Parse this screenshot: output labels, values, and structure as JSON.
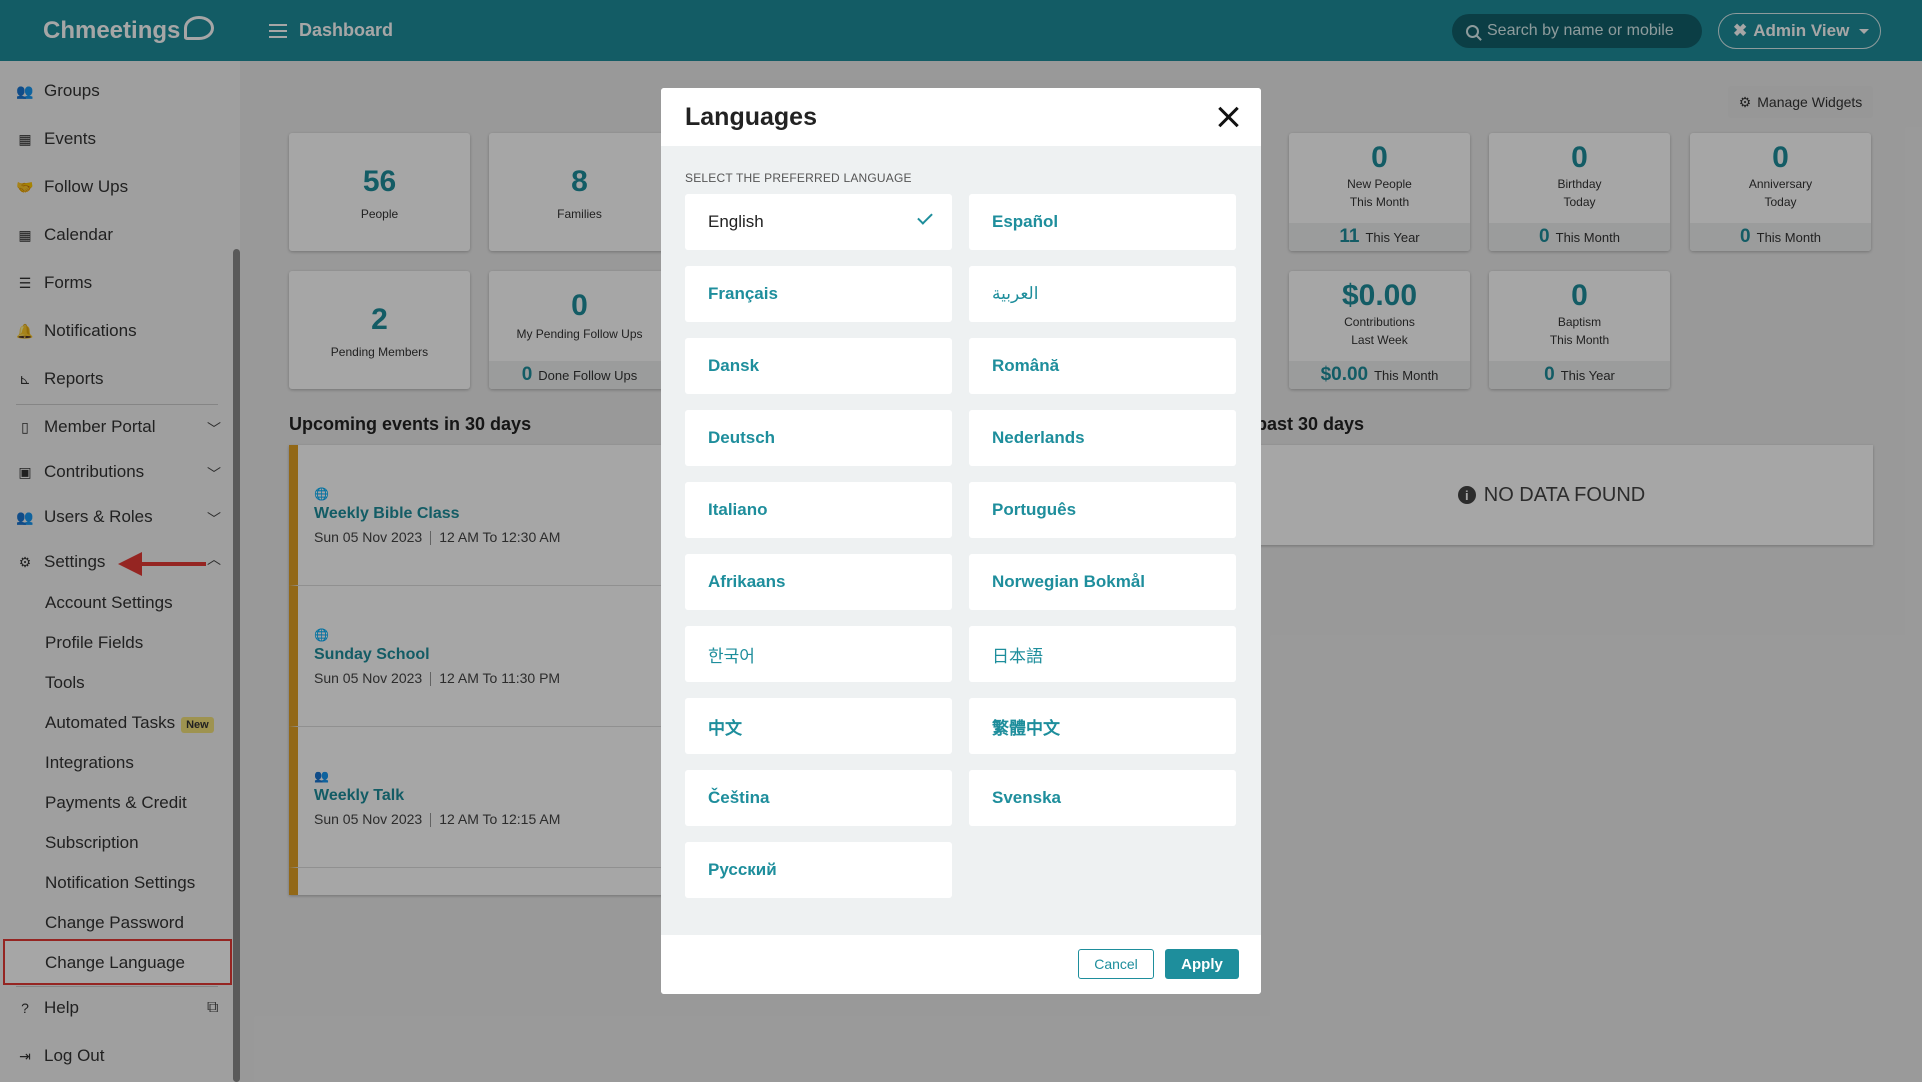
{
  "app": {
    "logo": "Chmeetings",
    "page_title": "Dashboard"
  },
  "header": {
    "search_placeholder": "Search by name or mobile",
    "admin_label": "Admin View"
  },
  "sidebar": {
    "items": [
      {
        "label": "Groups",
        "icon": "groups-icon"
      },
      {
        "label": "Events",
        "icon": "calendar-icon"
      },
      {
        "label": "Follow Ups",
        "icon": "handshake-icon"
      },
      {
        "label": "Calendar",
        "icon": "calendar-icon"
      },
      {
        "label": "Forms",
        "icon": "list-icon"
      },
      {
        "label": "Notifications",
        "icon": "bell-icon"
      },
      {
        "label": "Reports",
        "icon": "chart-icon"
      },
      {
        "label": "Member Portal",
        "icon": "mobile-icon"
      },
      {
        "label": "Contributions",
        "icon": "money-icon"
      },
      {
        "label": "Users & Roles",
        "icon": "users-icon"
      },
      {
        "label": "Settings",
        "icon": "gear-icon"
      }
    ],
    "settings_sub": [
      "Account Settings",
      "Profile Fields",
      "Tools",
      "Automated Tasks",
      "Integrations",
      "Payments & Credit",
      "Subscription",
      "Notification Settings",
      "Change Password",
      "Change Language"
    ],
    "new_badge": "New",
    "help": "Help",
    "logout": "Log Out"
  },
  "dashboard": {
    "manage_widgets": "Manage Widgets",
    "cards": [
      {
        "value": "56",
        "label": "People"
      },
      {
        "value": "8",
        "label": "Families"
      },
      {
        "value": "0",
        "label1": "New People",
        "label2": "This Month",
        "foot_value": "11",
        "foot_label": "This Year"
      },
      {
        "value": "0",
        "label1": "Birthday",
        "label2": "Today",
        "foot_value": "0",
        "foot_label": "This Month"
      },
      {
        "value": "0",
        "label1": "Anniversary",
        "label2": "Today",
        "foot_value": "0",
        "foot_label": "This Month"
      },
      {
        "value": "2",
        "label": "Pending Members"
      },
      {
        "value": "0",
        "label": "My Pending Follow Ups",
        "foot_value": "0",
        "foot_label": "Done Follow Ups"
      },
      {
        "value": "$0.00",
        "label1": "Contributions",
        "label2": "Last Week",
        "foot_value": "$0.00",
        "foot_label": "This Month"
      },
      {
        "value": "0",
        "label1": "Baptism",
        "label2": "This Month",
        "foot_value": "0",
        "foot_label": "This Year"
      }
    ],
    "upcoming_title": "Upcoming events in 30 days",
    "past_title": "past 30 days",
    "no_data": "NO DATA FOUND",
    "events": [
      {
        "title": "Weekly Bible Class",
        "date": "Sun 05 Nov  2023",
        "time": "12 AM To 12:30 AM"
      },
      {
        "title": "Sunday School",
        "date": "Sun 05 Nov  2023",
        "time": "12 AM To 11:30 PM"
      },
      {
        "title": "Weekly Talk",
        "date": "Sun 05 Nov  2023",
        "time": "12 AM To 12:15 AM"
      }
    ]
  },
  "modal": {
    "title": "Languages",
    "subtitle": "SELECT THE PREFERRED LANGUAGE",
    "languages": [
      "English",
      "Español",
      "Français",
      "العربية",
      "Dansk",
      "Română",
      "Deutsch",
      "Nederlands",
      "Italiano",
      "Português",
      "Afrikaans",
      "Norwegian Bokmål",
      "한국어",
      "日本語",
      "中文",
      "繁體中文",
      "Čeština",
      "Svenska",
      "Русский"
    ],
    "selected": "English",
    "cancel": "Cancel",
    "apply": "Apply"
  },
  "colors": {
    "accent": "#1e8e9c",
    "event_bar": "#e0a024",
    "highlight": "#e53935"
  }
}
